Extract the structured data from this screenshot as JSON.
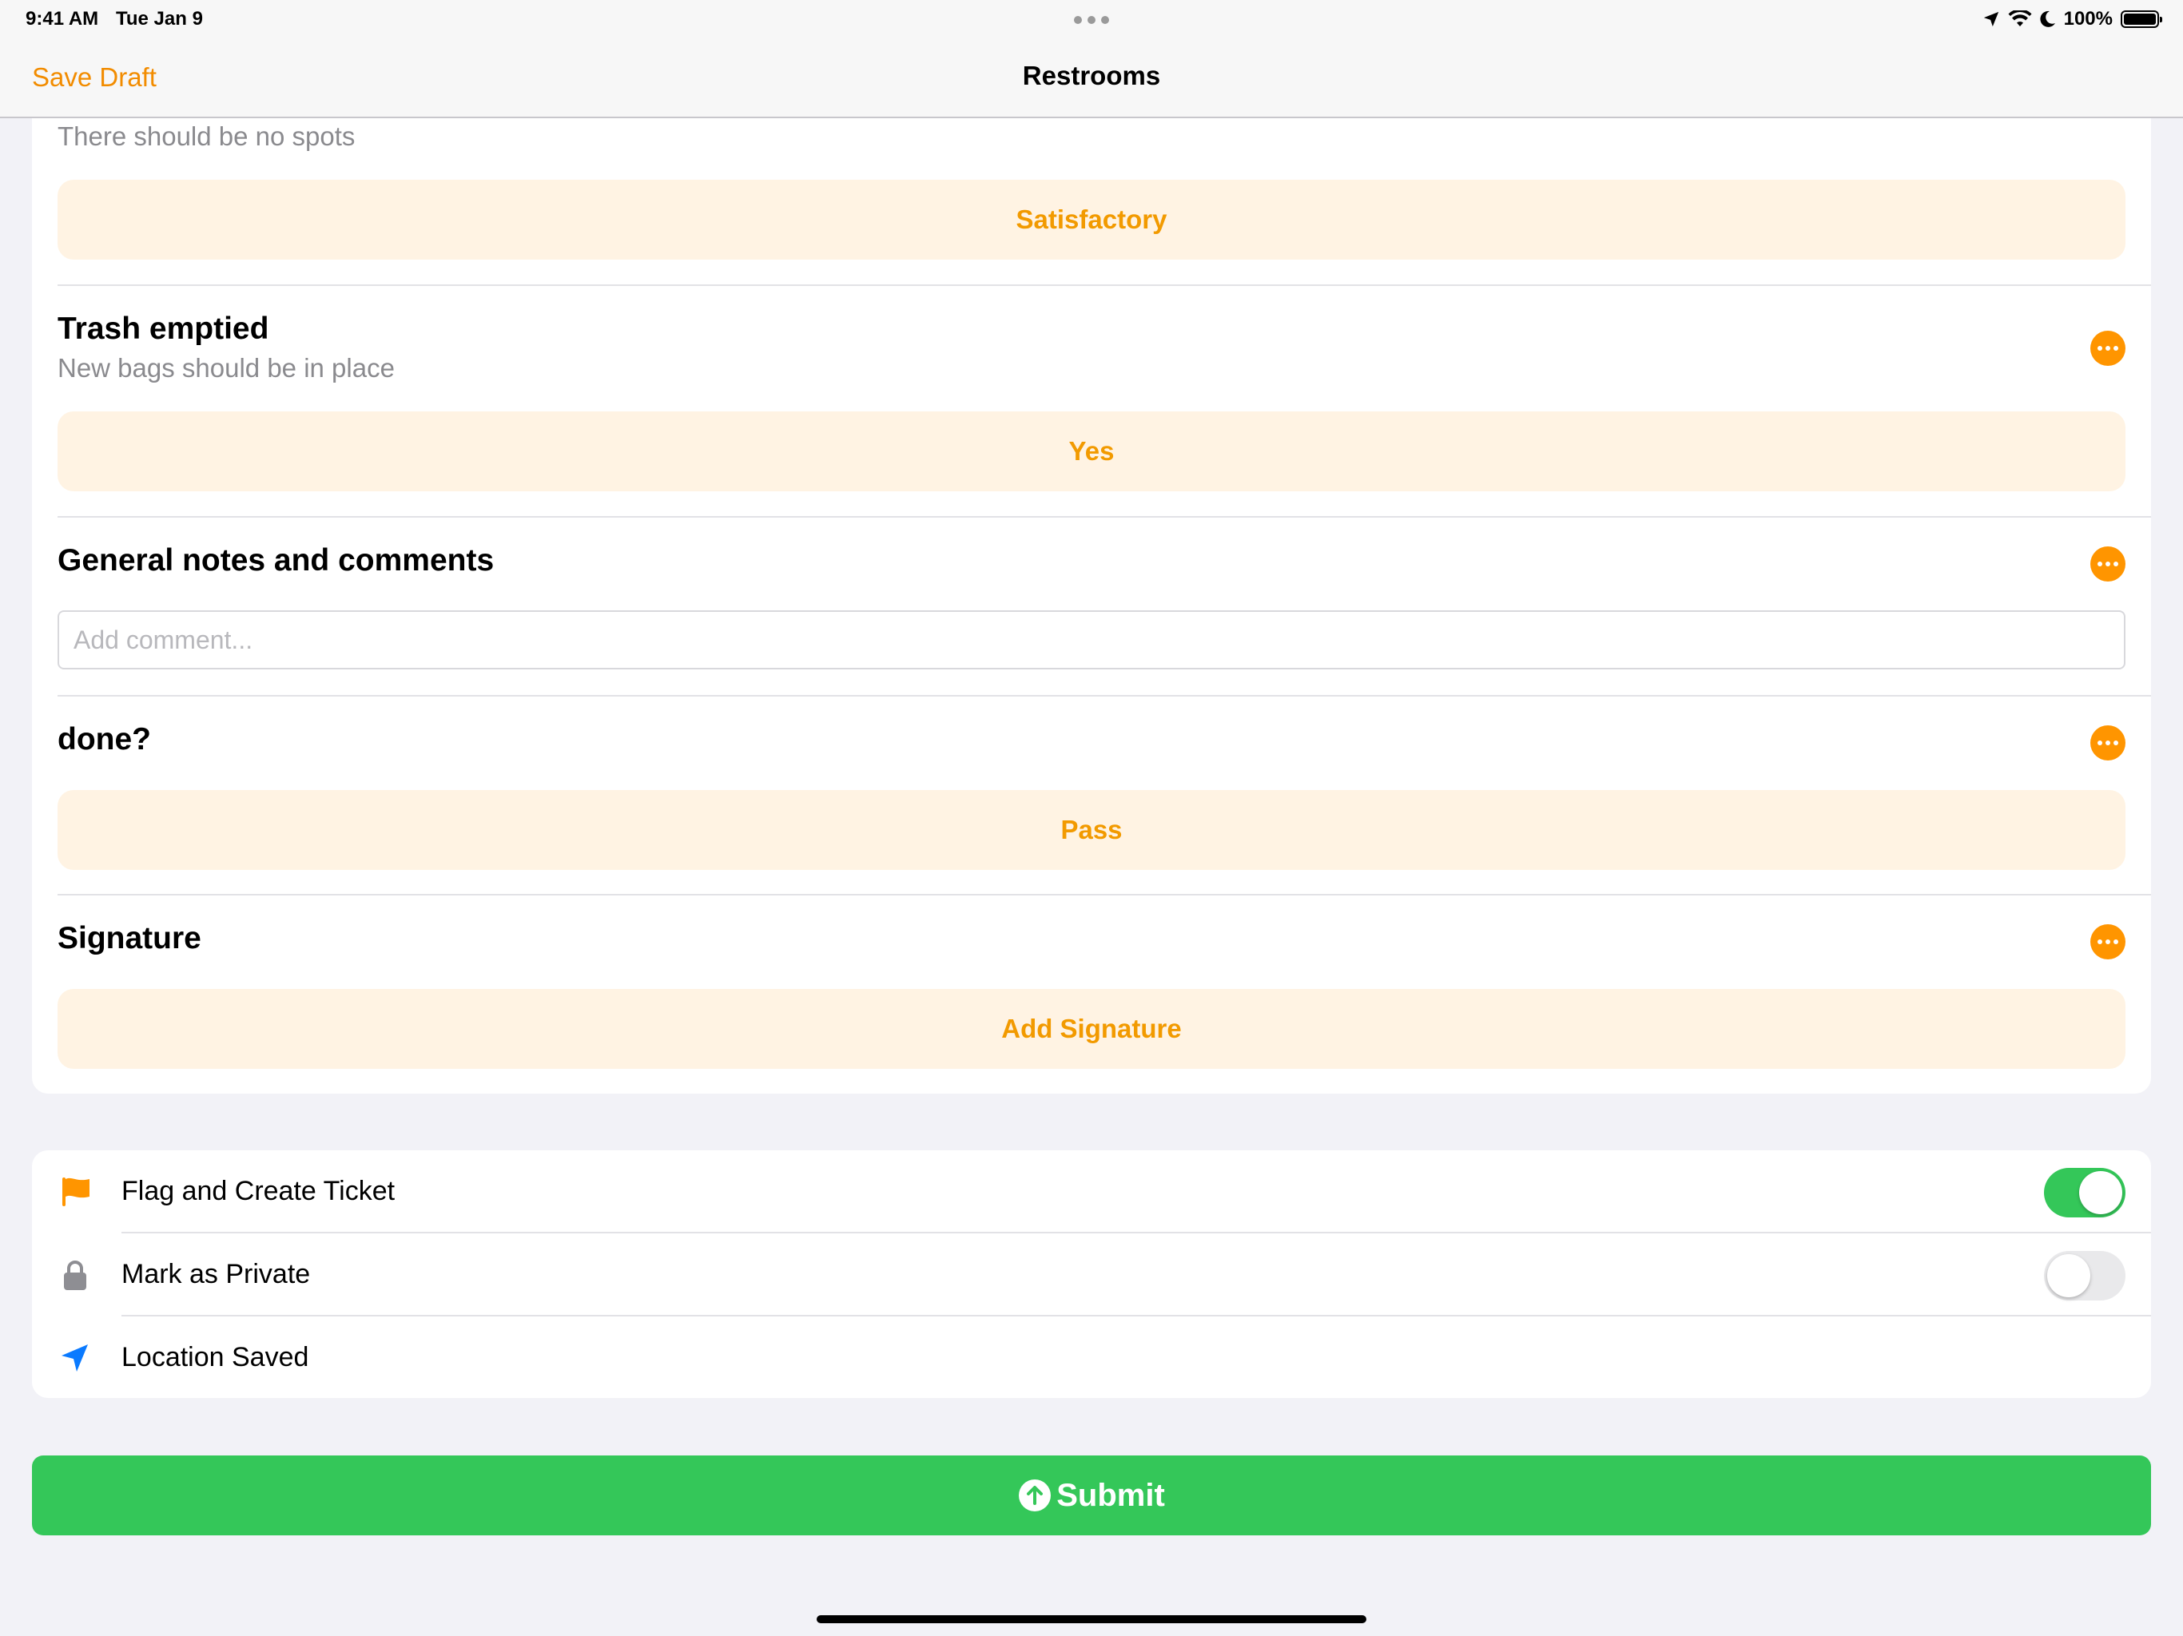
{
  "status_bar": {
    "time": "9:41 AM",
    "date": "Tue Jan 9",
    "battery": "100%",
    "icons": [
      "location-arrow-icon",
      "wifi-icon",
      "moon-icon",
      "battery-icon"
    ]
  },
  "nav": {
    "left_label": "Save Draft",
    "title": "Restrooms"
  },
  "questions": [
    {
      "title": "",
      "subtitle": "There should be no spots",
      "answer": "Satisfactory"
    },
    {
      "title": "Trash emptied",
      "subtitle": "New bags should be in place",
      "answer": "Yes"
    },
    {
      "title": "General notes and comments",
      "comment_placeholder": "Add comment..."
    },
    {
      "title": "done?",
      "answer": "Pass"
    },
    {
      "title": "Signature",
      "answer": "Add Signature"
    }
  ],
  "options": [
    {
      "label": "Flag and Create Ticket",
      "icon": "flag-icon",
      "toggle": true
    },
    {
      "label": "Mark as Private",
      "icon": "lock-icon",
      "toggle": false
    },
    {
      "label": "Location Saved",
      "icon": "location-arrow-icon"
    }
  ],
  "submit": {
    "label": "Submit",
    "icon": "arrow-up-circle-icon"
  },
  "colors": {
    "accent": "#FF9500",
    "answer_bg": "#FFF3E3",
    "success": "#34C759",
    "location_blue": "#0A7AFF"
  }
}
